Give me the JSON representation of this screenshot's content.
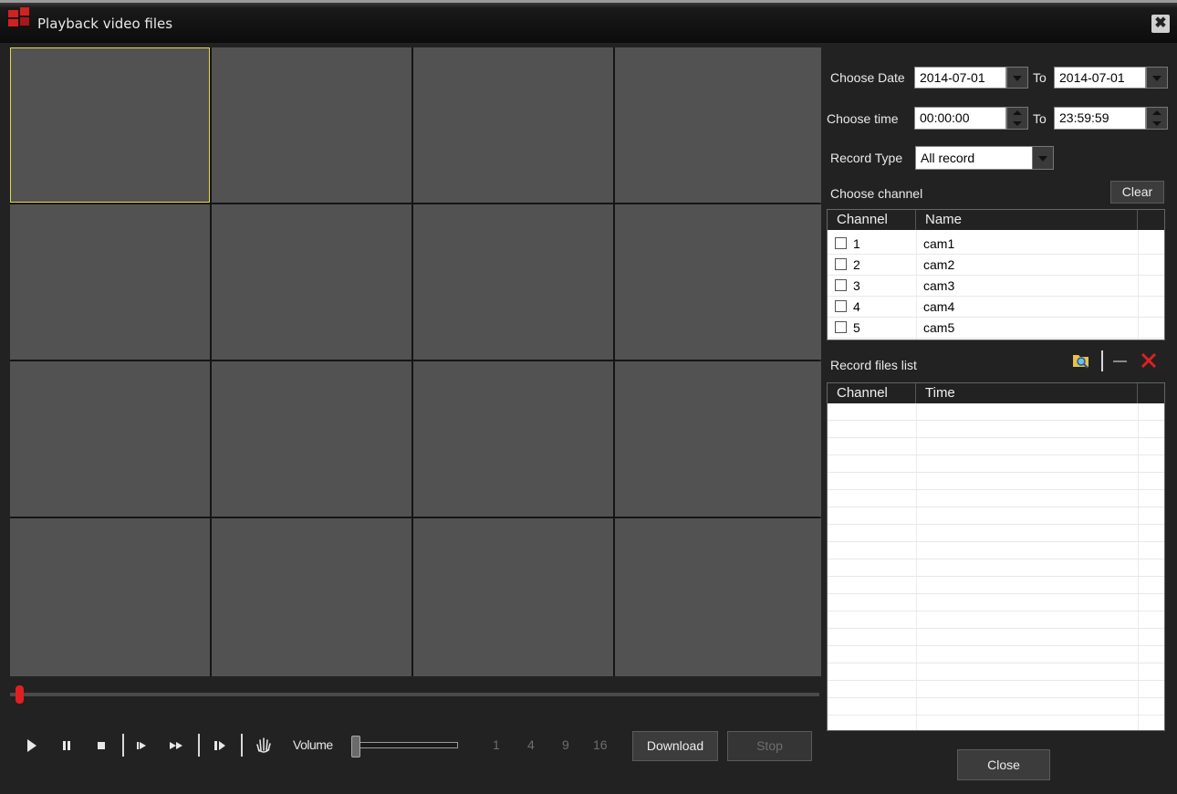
{
  "window": {
    "title": "Playback video files",
    "close_glyph": "✖"
  },
  "controls": {
    "play": "▶",
    "pause": "⏸",
    "stop": "■",
    "slow": "⏵",
    "fast": "⏩",
    "step": "⏯",
    "hand": "✋",
    "volume_label": "Volume",
    "splits": [
      "1",
      "4",
      "9",
      "16"
    ],
    "download": "Download",
    "stop_btn": "Stop"
  },
  "progress": {
    "position_fraction": 0.0
  },
  "volume": {
    "level_fraction": 0.0
  },
  "filter": {
    "date_label": "Choose Date",
    "date_from": "2014-07-01",
    "to1": "To",
    "date_to": "2014-07-01",
    "time_label": "Choose time",
    "time_from": "00:00:00",
    "to2": "To",
    "time_to": "23:59:59",
    "type_label": "Record Type",
    "type_value": "All record",
    "channel_label": "Choose channel",
    "clear": "Clear"
  },
  "channels": {
    "headers": [
      "Channel",
      "Name"
    ],
    "rows": [
      {
        "ch": "1",
        "name": "cam1"
      },
      {
        "ch": "2",
        "name": "cam2"
      },
      {
        "ch": "3",
        "name": "cam3"
      },
      {
        "ch": "4",
        "name": "cam4"
      },
      {
        "ch": "5",
        "name": "cam5"
      }
    ]
  },
  "records": {
    "label": "Record files list",
    "headers": [
      "Channel",
      "Time"
    ],
    "icons": [
      "search-folder-icon",
      "minus-icon",
      "delete-icon"
    ]
  },
  "footer": {
    "close": "Close"
  },
  "colors": {
    "accent_red": "#e02020",
    "selection_yellow": "#e6d84a",
    "tile": "#525252"
  }
}
